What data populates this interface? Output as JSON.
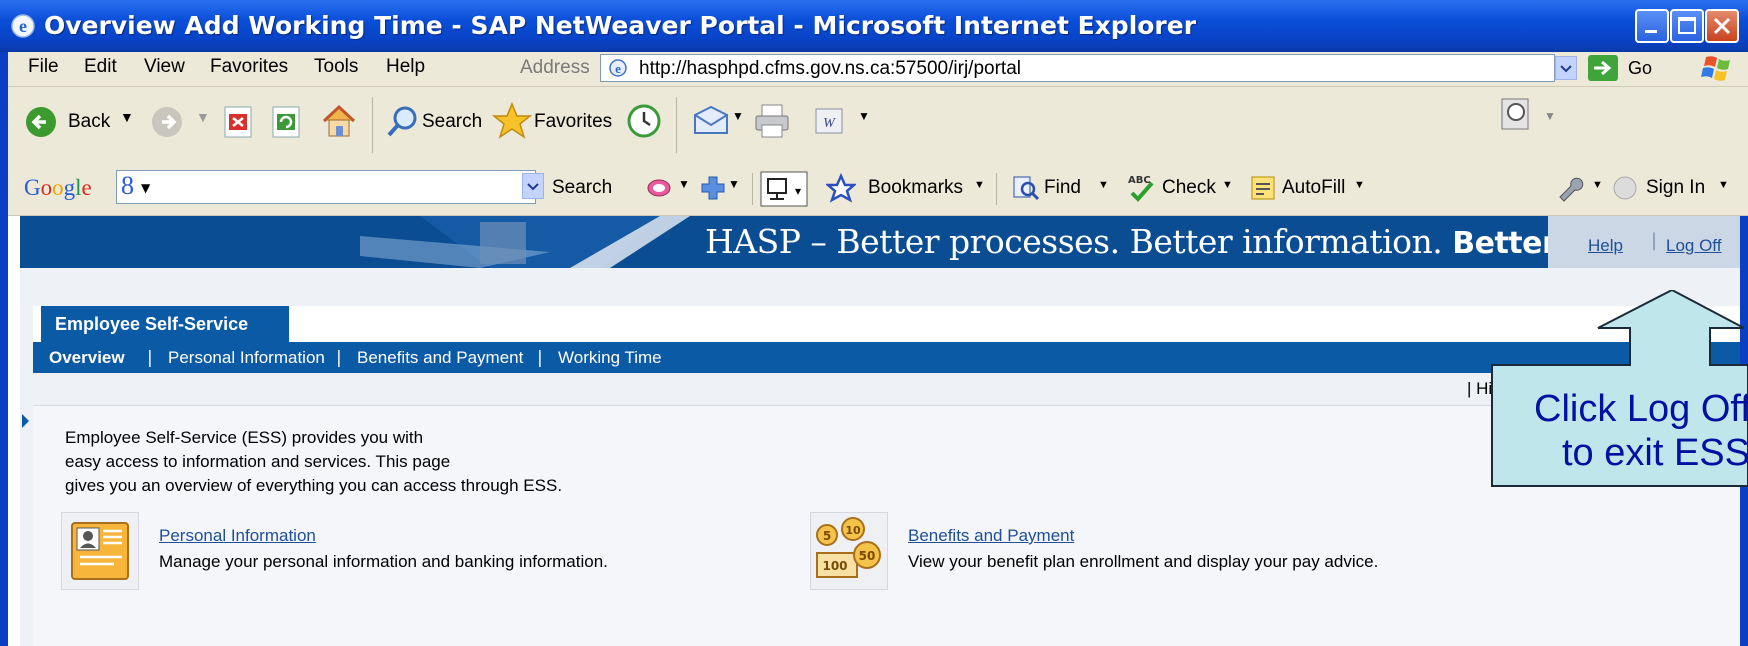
{
  "window": {
    "title": "Overview Add Working Time - SAP NetWeaver Portal - Microsoft Internet Explorer"
  },
  "menu": [
    "File",
    "Edit",
    "View",
    "Favorites",
    "Tools",
    "Help"
  ],
  "address": {
    "label": "Address",
    "url": "http://hasphpd.cfms.gov.ns.ca:57500/irj/portal",
    "go_label": "Go"
  },
  "toolbar": {
    "back": "Back",
    "search": "Search",
    "favorites": "Favorites"
  },
  "google_bar": {
    "logo": "Google",
    "search": "Search",
    "bookmarks": "Bookmarks",
    "find": "Find",
    "check": "Check",
    "autofill": "AutoFill",
    "sign_in": "Sign In"
  },
  "portal": {
    "slogan_regular": "HASP – Better processes. Better information.",
    "slogan_bold": "Better care.",
    "help": "Help",
    "log_off": "Log Off",
    "top_tab": "Employee Self-Service",
    "subnav": [
      "Overview",
      "Personal Information",
      "Benefits and Payment",
      "Working Time"
    ],
    "history": "|  History",
    "intro": [
      "Employee Self-Service (ESS) provides you with",
      "easy access to information and services. This page",
      "gives you an overview of everything you can access through ESS."
    ],
    "services": [
      {
        "title": "Personal Information",
        "desc": "Manage your personal information and banking information."
      },
      {
        "title": "Benefits and Payment",
        "desc": "View your benefit plan enrollment and display your pay advice."
      }
    ]
  },
  "callout": {
    "line1": "Click Log Off",
    "line2": "to exit ESS"
  },
  "colors": {
    "titlebar": "#0a4ed8",
    "portal_nav": "#0b5aa6",
    "banner": "#0b4d92",
    "callout_fill": "#bfe6ea",
    "callout_text": "#0010a0"
  }
}
